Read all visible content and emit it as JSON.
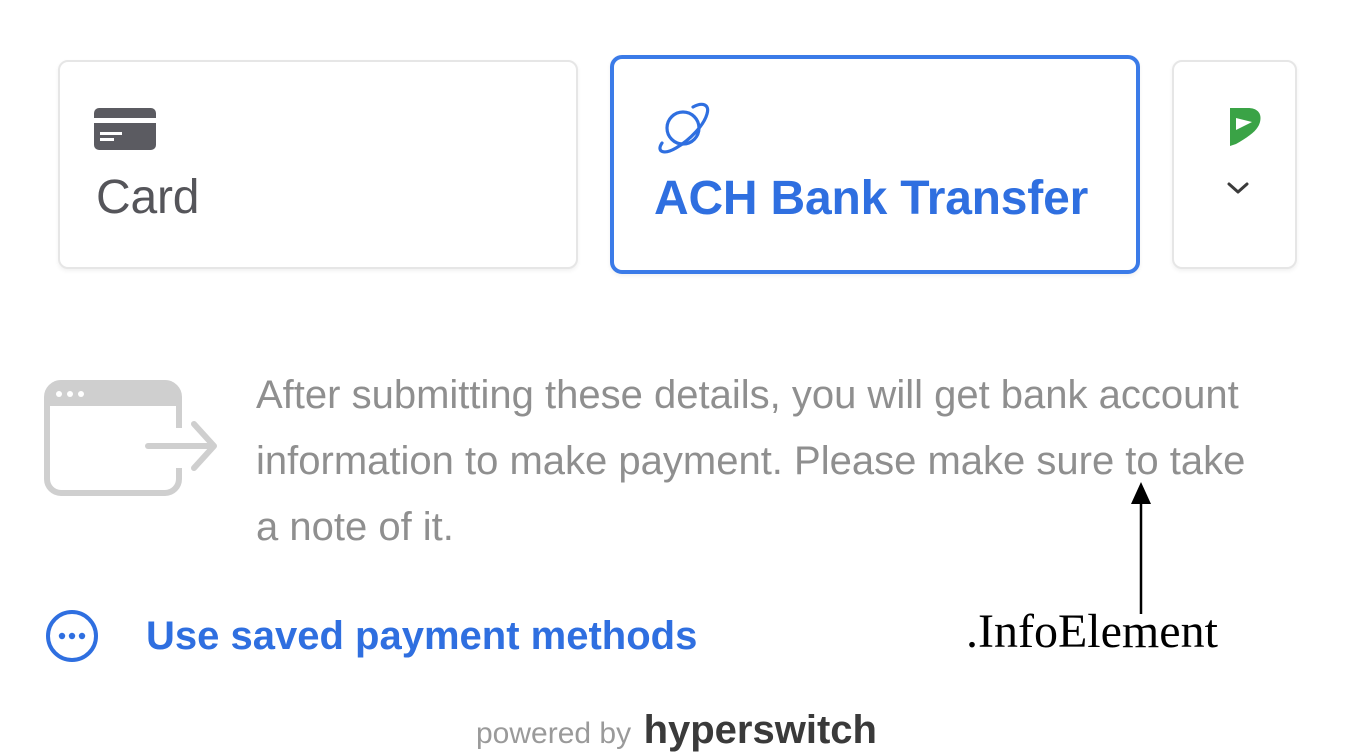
{
  "tabs": {
    "card": {
      "label": "Card",
      "icon": "card-icon"
    },
    "ach": {
      "label": "ACH Bank Transfer",
      "icon": "globe-orbit-icon"
    },
    "more": {
      "icon": "payment-logo-icon",
      "chevron_icon": "chevron-down-icon"
    }
  },
  "info": {
    "icon": "browser-redirect-icon",
    "text": "After submitting these details, you will get bank account information to make payment. Please make sure to take a note of it."
  },
  "saved_methods": {
    "label": "Use saved payment methods",
    "icon": "more-dots-icon"
  },
  "annotation": {
    "label": ".InfoElement"
  },
  "footer": {
    "prefix": "powered by",
    "brand": "hyperswitch"
  },
  "colors": {
    "accent": "#2f6fe0",
    "muted_text": "#8f8f8f",
    "card_text": "#55555a",
    "logo_green": "#3aa346"
  }
}
